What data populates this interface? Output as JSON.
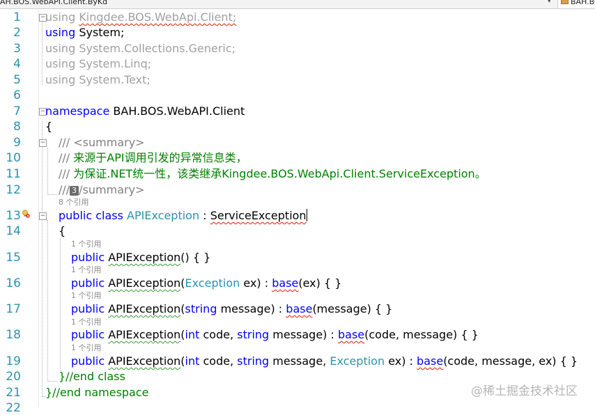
{
  "topbar": {
    "breadcrumb": "AH.BOS.WebAPI.Client.ByKd",
    "member_nav": "BAH.BOS"
  },
  "editor": {
    "line_numbers": [
      "1",
      "2",
      "3",
      "4",
      "5",
      "6",
      "7",
      "8",
      "9",
      "10",
      "11",
      "12",
      "13",
      "14",
      "15",
      "16",
      "17",
      "18",
      "19",
      "20",
      "21",
      "22"
    ],
    "lens": {
      "refs_8": "8 个引用",
      "refs_1": "1 个引用"
    },
    "tokens": {
      "using": "using",
      "ns1": "Kingdee.BOS.WebApi.Client;",
      "ns2": "System;",
      "ns3": "System.Collections.Generic;",
      "ns4": "System.Linq;",
      "ns5": "System.Text;",
      "namespace_kw": "namespace",
      "namespace_name": "BAH.BOS.WebAPI.Client",
      "open_brace": "{",
      "doc_prefix": "///",
      "summary_open": "<summary>",
      "doc_line1": "来源于API调用引发的异常信息类，",
      "doc_line2": "为保证.NET统一性，该类继承Kingdee.BOS.WebApi.Client.ServiceException。",
      "summary_close": "/summary>",
      "peek_badge": "3",
      "public_kw": "public",
      "class_kw": "class",
      "class_name": "APIException",
      "colon": ":",
      "base_type": "ServiceException",
      "ctor_name": "APIException",
      "ctor1_rest": "() { }",
      "exception_type": "Exception",
      "base_kw": "base",
      "string_kw": "string",
      "int_kw": "int",
      "ctor2_params": " ex) :",
      "ctor2_tail": "(ex) { }",
      "ctor3_params": " message) :",
      "ctor3_tail": "(message) { }",
      "ctor4_params": " message) :",
      "ctor4_code": " code, ",
      "ctor4_tail": "(code, message) { }",
      "ctor5_code": " code, ",
      "ctor5_message": " message, ",
      "ctor5_params": " ex) :",
      "ctor5_tail": "(code, message, ex) { }",
      "end_class": "}//end class",
      "end_namespace": "}//end namespace"
    }
  },
  "watermark": "@稀土掘金技术社区",
  "icons": {
    "warning": "lightbulb-error-icon",
    "fold": "collapse-box-icon"
  }
}
